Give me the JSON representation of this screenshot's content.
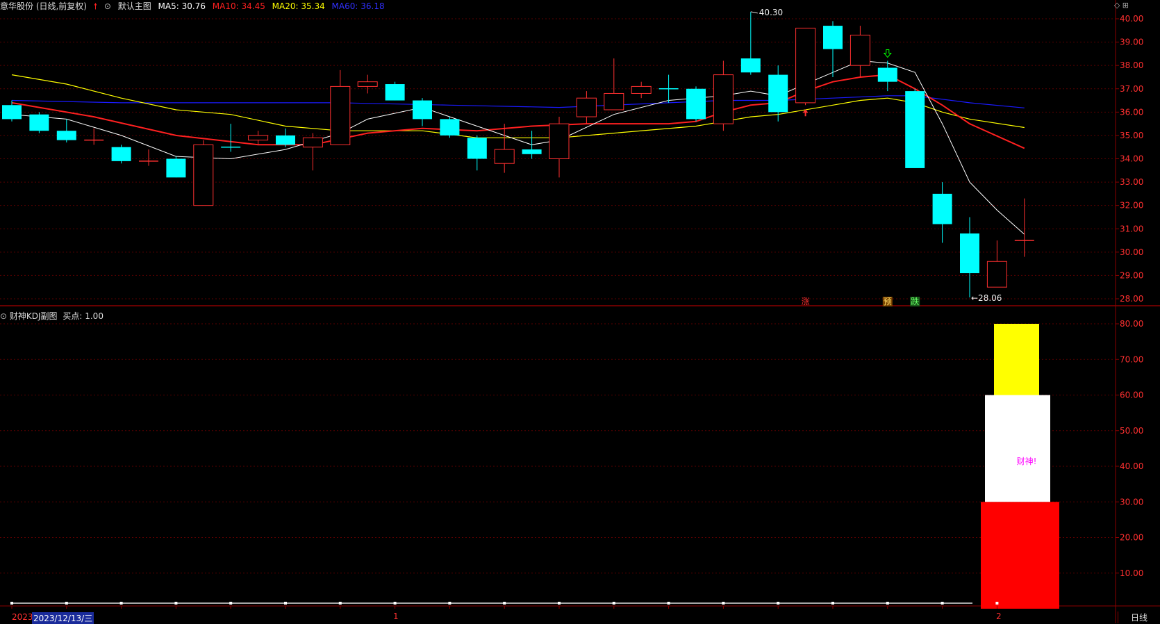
{
  "header": {
    "stock": "意华股份 (日线,前复权)",
    "main_chart": "默认主图",
    "ma": [
      {
        "label": "MA5: 30.76",
        "color": "#ffffff"
      },
      {
        "label": "MA10: 34.45",
        "color": "#ff2020"
      },
      {
        "label": "MA20: 35.34",
        "color": "#ffff00"
      },
      {
        "label": "MA60: 36.18",
        "color": "#1a1aff"
      }
    ]
  },
  "price_axis": [
    "40.00",
    "39.00",
    "38.00",
    "37.00",
    "36.00",
    "35.00",
    "34.00",
    "33.00",
    "32.00",
    "31.00",
    "30.00",
    "29.00",
    "28.00"
  ],
  "kdj_axis": [
    "80.00",
    "70.00",
    "60.00",
    "50.00",
    "40.00",
    "30.00",
    "20.00",
    "10.00"
  ],
  "markers": {
    "high": "40.30",
    "low": "28.06",
    "zhang": "涨",
    "yu": "预",
    "die": "跌"
  },
  "kdj": {
    "title": "财神KDJ副图",
    "buy_label": "买点: 1.00",
    "caishen": "财神!"
  },
  "bottom": {
    "year": "2023",
    "date": "2023/12/13/三",
    "tick1": "1",
    "tick2": "2",
    "period": "日线"
  },
  "colors": {
    "up": "#ff3030",
    "down": "#00ffff",
    "ma5": "#ffffff",
    "ma10": "#ff2020",
    "ma20": "#ffff00",
    "ma60": "#1a1aff"
  },
  "chart_data": {
    "type": "candlestick",
    "candles": [
      {
        "o": 36.3,
        "c": 35.7,
        "h": 36.5,
        "l": 35.6
      },
      {
        "o": 35.9,
        "c": 35.2,
        "h": 36.0,
        "l": 35.1
      },
      {
        "o": 35.2,
        "c": 34.8,
        "h": 35.7,
        "l": 34.7
      },
      {
        "o": 34.8,
        "c": 34.8,
        "h": 35.3,
        "l": 34.6
      },
      {
        "o": 34.5,
        "c": 33.9,
        "h": 34.6,
        "l": 33.8
      },
      {
        "o": 33.9,
        "c": 33.9,
        "h": 34.4,
        "l": 33.7
      },
      {
        "o": 34.0,
        "c": 33.2,
        "h": 34.1,
        "l": 33.2
      },
      {
        "o": 32.0,
        "c": 34.6,
        "h": 34.8,
        "l": 32.0
      },
      {
        "o": 34.5,
        "c": 34.5,
        "h": 35.5,
        "l": 34.3
      },
      {
        "o": 34.8,
        "c": 35.0,
        "h": 35.2,
        "l": 34.6
      },
      {
        "o": 35.0,
        "c": 34.6,
        "h": 35.3,
        "l": 34.5
      },
      {
        "o": 34.5,
        "c": 34.9,
        "h": 35.1,
        "l": 33.5
      },
      {
        "o": 34.6,
        "c": 37.1,
        "h": 37.8,
        "l": 34.6
      },
      {
        "o": 37.1,
        "c": 37.3,
        "h": 37.6,
        "l": 36.8
      },
      {
        "o": 37.2,
        "c": 36.5,
        "h": 37.3,
        "l": 36.5
      },
      {
        "o": 36.5,
        "c": 35.7,
        "h": 36.6,
        "l": 35.4
      },
      {
        "o": 35.7,
        "c": 35.0,
        "h": 35.8,
        "l": 34.9
      },
      {
        "o": 34.9,
        "c": 34.0,
        "h": 35.0,
        "l": 33.5
      },
      {
        "o": 33.8,
        "c": 34.4,
        "h": 35.5,
        "l": 33.4
      },
      {
        "o": 34.4,
        "c": 34.2,
        "h": 35.2,
        "l": 34.0
      },
      {
        "o": 34.0,
        "c": 35.5,
        "h": 35.8,
        "l": 33.2
      },
      {
        "o": 35.8,
        "c": 36.6,
        "h": 36.9,
        "l": 35.5
      },
      {
        "o": 36.1,
        "c": 36.8,
        "h": 38.3,
        "l": 36.1
      },
      {
        "o": 36.8,
        "c": 37.1,
        "h": 37.3,
        "l": 36.6
      },
      {
        "o": 37.0,
        "c": 37.0,
        "h": 37.6,
        "l": 36.4
      },
      {
        "o": 37.0,
        "c": 35.7,
        "h": 37.1,
        "l": 35.6
      },
      {
        "o": 35.5,
        "c": 37.6,
        "h": 38.2,
        "l": 35.2
      },
      {
        "o": 38.3,
        "c": 37.7,
        "h": 40.3,
        "l": 37.6
      },
      {
        "o": 37.6,
        "c": 36.0,
        "h": 38.0,
        "l": 35.6
      },
      {
        "o": 36.4,
        "c": 39.6,
        "h": 39.6,
        "l": 36.3
      },
      {
        "o": 39.7,
        "c": 38.7,
        "h": 39.9,
        "l": 37.5
      },
      {
        "o": 38.0,
        "c": 39.3,
        "h": 39.7,
        "l": 37.5
      },
      {
        "o": 37.9,
        "c": 37.3,
        "h": 38.2,
        "l": 36.9
      },
      {
        "o": 36.9,
        "c": 33.6,
        "h": 37.0,
        "l": 33.6
      },
      {
        "o": 32.5,
        "c": 31.2,
        "h": 33.0,
        "l": 30.4
      },
      {
        "o": 30.8,
        "c": 29.1,
        "h": 31.5,
        "l": 28.06
      },
      {
        "o": 28.5,
        "c": 29.6,
        "h": 30.5,
        "l": 28.5
      },
      {
        "o": 30.5,
        "c": 30.5,
        "h": 32.3,
        "l": 29.8
      }
    ],
    "ma5": [
      [
        0,
        35.9
      ],
      [
        2,
        35.7
      ],
      [
        4,
        35.0
      ],
      [
        6,
        34.1
      ],
      [
        8,
        34.0
      ],
      [
        10,
        34.4
      ],
      [
        12,
        35.1
      ],
      [
        13,
        35.7
      ],
      [
        15,
        36.2
      ],
      [
        17,
        35.4
      ],
      [
        19,
        34.6
      ],
      [
        20,
        34.8
      ],
      [
        22,
        35.9
      ],
      [
        24,
        36.5
      ],
      [
        26,
        36.7
      ],
      [
        27,
        36.9
      ],
      [
        28,
        36.7
      ],
      [
        30,
        37.7
      ],
      [
        31,
        38.2
      ],
      [
        32,
        38.1
      ],
      [
        33,
        37.7
      ],
      [
        34,
        35.5
      ],
      [
        35,
        33.0
      ],
      [
        36,
        31.8
      ],
      [
        37,
        30.76
      ]
    ],
    "ma10": [
      [
        0,
        36.4
      ],
      [
        3,
        35.8
      ],
      [
        6,
        35.0
      ],
      [
        9,
        34.6
      ],
      [
        11,
        34.6
      ],
      [
        13,
        35.1
      ],
      [
        15,
        35.3
      ],
      [
        17,
        35.2
      ],
      [
        19,
        35.4
      ],
      [
        21,
        35.5
      ],
      [
        24,
        35.5
      ],
      [
        25,
        35.6
      ],
      [
        26,
        36.0
      ],
      [
        27,
        36.3
      ],
      [
        28,
        36.4
      ],
      [
        29,
        36.9
      ],
      [
        30,
        37.3
      ],
      [
        31,
        37.5
      ],
      [
        32,
        37.6
      ],
      [
        33,
        37.0
      ],
      [
        34,
        36.3
      ],
      [
        35,
        35.5
      ],
      [
        37,
        34.45
      ]
    ],
    "ma20": [
      [
        0,
        37.6
      ],
      [
        2,
        37.2
      ],
      [
        4,
        36.6
      ],
      [
        6,
        36.1
      ],
      [
        8,
        35.9
      ],
      [
        10,
        35.4
      ],
      [
        12,
        35.2
      ],
      [
        15,
        35.2
      ],
      [
        17,
        34.9
      ],
      [
        20,
        34.9
      ],
      [
        22,
        35.1
      ],
      [
        25,
        35.4
      ],
      [
        26,
        35.6
      ],
      [
        27,
        35.8
      ],
      [
        28,
        35.9
      ],
      [
        30,
        36.3
      ],
      [
        31,
        36.5
      ],
      [
        32,
        36.6
      ],
      [
        33,
        36.4
      ],
      [
        34,
        36.0
      ],
      [
        35,
        35.7
      ],
      [
        37,
        35.34
      ]
    ],
    "ma60": [
      [
        0,
        36.5
      ],
      [
        4,
        36.4
      ],
      [
        8,
        36.4
      ],
      [
        12,
        36.4
      ],
      [
        16,
        36.3
      ],
      [
        20,
        36.2
      ],
      [
        24,
        36.4
      ],
      [
        26,
        36.5
      ],
      [
        28,
        36.5
      ],
      [
        30,
        36.6
      ],
      [
        32,
        36.7
      ],
      [
        33,
        36.7
      ],
      [
        35,
        36.4
      ],
      [
        37,
        36.18
      ]
    ],
    "signals": [
      {
        "i": 29,
        "type": "up-arrow"
      },
      {
        "i": 32,
        "type": "down-arrow"
      }
    ],
    "kdj_bars": [
      {
        "from": 0,
        "to": 30,
        "color": "#ff0000"
      },
      {
        "from": 30,
        "to": 60,
        "color": "#ffffff"
      },
      {
        "from": 60,
        "to": 80,
        "color": "#ffff00"
      }
    ],
    "price_range": [
      27.6,
      40.4
    ],
    "kdj_range": [
      0,
      85
    ]
  }
}
